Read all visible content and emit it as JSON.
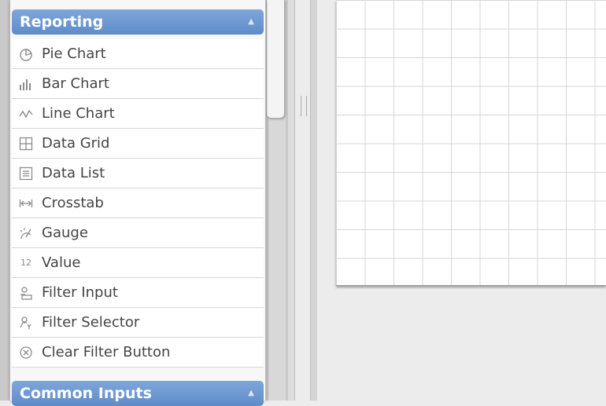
{
  "toolbox": {
    "sections": [
      {
        "title": "Reporting"
      },
      {
        "title": "Common Inputs"
      }
    ],
    "reporting_items": [
      {
        "label": "Pie Chart",
        "icon": "pie-chart-icon"
      },
      {
        "label": "Bar Chart",
        "icon": "bar-chart-icon"
      },
      {
        "label": "Line Chart",
        "icon": "line-chart-icon"
      },
      {
        "label": "Data Grid",
        "icon": "data-grid-icon"
      },
      {
        "label": "Data List",
        "icon": "data-list-icon"
      },
      {
        "label": "Crosstab",
        "icon": "crosstab-icon"
      },
      {
        "label": "Gauge",
        "icon": "gauge-icon"
      },
      {
        "label": "Value",
        "icon": "value-icon",
        "glyph": "12"
      },
      {
        "label": "Filter Input",
        "icon": "filter-input-icon"
      },
      {
        "label": "Filter Selector",
        "icon": "filter-selector-icon"
      },
      {
        "label": "Clear Filter Button",
        "icon": "clear-filter-icon"
      }
    ]
  },
  "colors": {
    "section_header": "#6b95ce",
    "canvas": "#ffffff",
    "grid_line": "#d5d5d5"
  }
}
